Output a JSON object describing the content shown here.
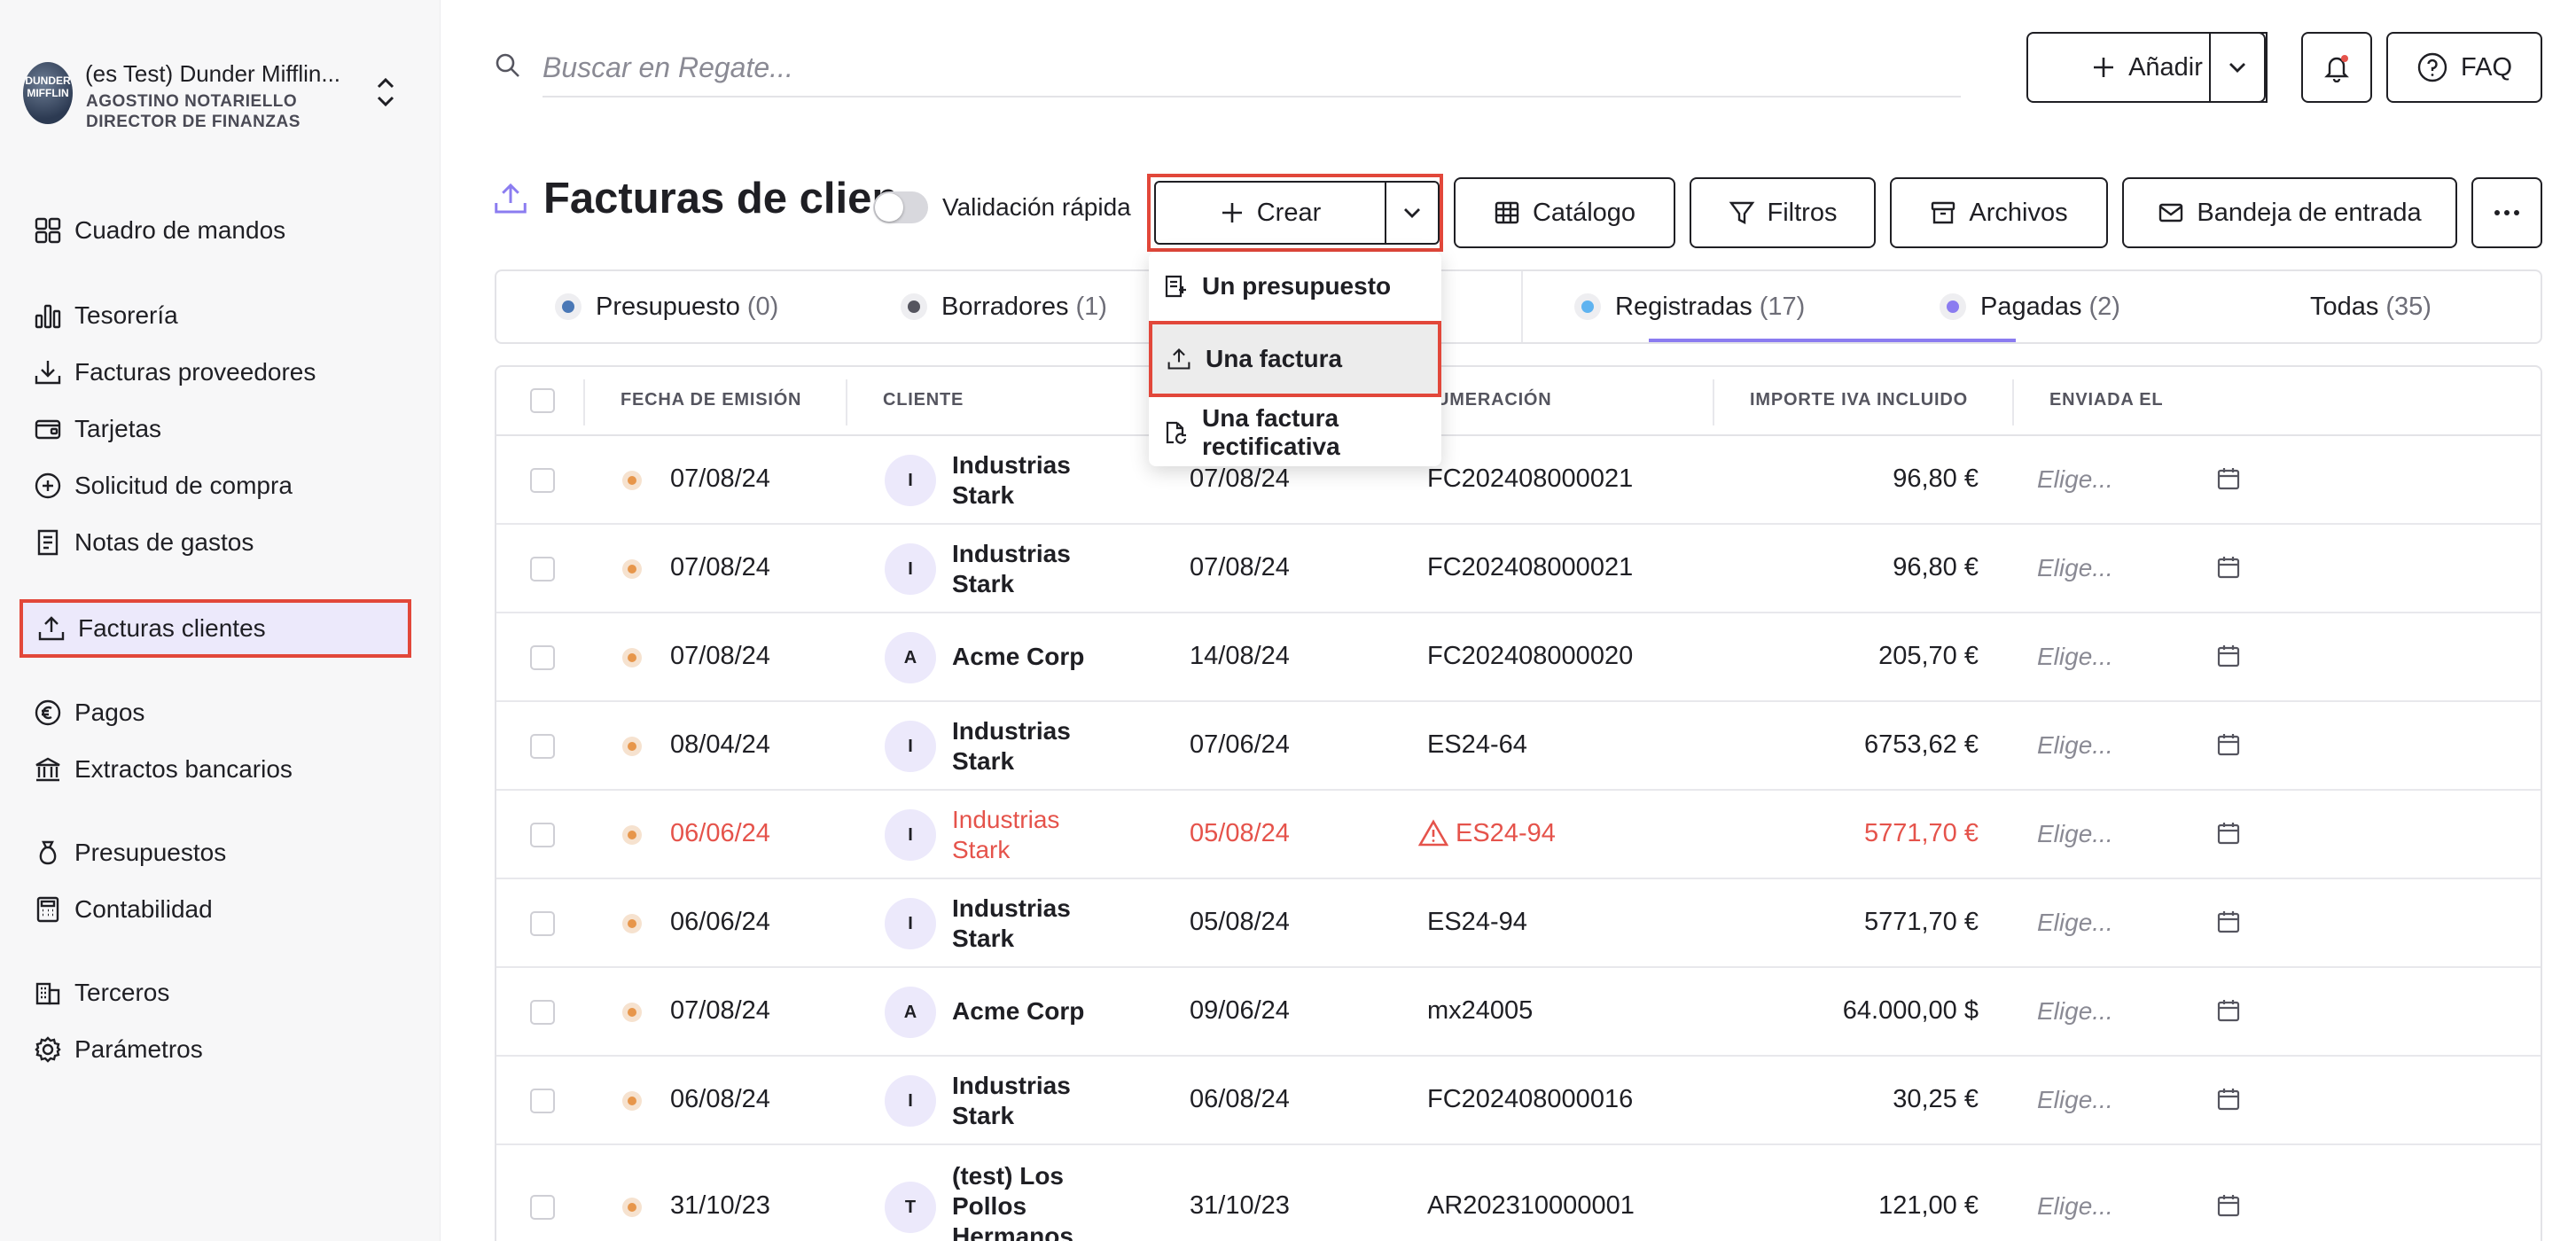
{
  "company": {
    "name": "(es Test) Dunder Mifflin...",
    "logo_text": "DUNDER MIFFLIN",
    "user": "AGOSTINO NOTARIELLO",
    "role": "DIRECTOR DE FINANZAS"
  },
  "sidebar": {
    "items": [
      {
        "label": "Cuadro de mandos",
        "icon": "dashboard-icon"
      },
      {
        "label": "Tesorería",
        "icon": "bar-chart-icon"
      },
      {
        "label": "Facturas proveedores",
        "icon": "download-tray-icon"
      },
      {
        "label": "Tarjetas",
        "icon": "wallet-icon"
      },
      {
        "label": "Solicitud de compra",
        "icon": "plus-circle-icon"
      },
      {
        "label": "Notas de gastos",
        "icon": "receipt-icon"
      },
      {
        "label": "Facturas clientes",
        "icon": "upload-tray-icon",
        "active": true
      },
      {
        "label": "Pagos",
        "icon": "euro-icon"
      },
      {
        "label": "Extractos bancarios",
        "icon": "bank-icon"
      },
      {
        "label": "Presupuestos",
        "icon": "money-bag-icon"
      },
      {
        "label": "Contabilidad",
        "icon": "calculator-icon"
      },
      {
        "label": "Terceros",
        "icon": "building-icon"
      },
      {
        "label": "Parámetros",
        "icon": "gear-icon"
      }
    ]
  },
  "search": {
    "placeholder": "Buscar en Regate..."
  },
  "toolbar": {
    "add_label": "Añadir",
    "faq_label": "FAQ"
  },
  "page": {
    "title": "Facturas de clientes",
    "quick_validation": "Validación rápida",
    "create_label": "Crear",
    "catalog_label": "Catálogo",
    "filters_label": "Filtros",
    "files_label": "Archivos",
    "inbox_label": "Bandeja de entrada"
  },
  "dropdown": {
    "items": [
      {
        "label": "Un presupuesto"
      },
      {
        "label": "Una factura"
      },
      {
        "label": "Una factura rectificativa"
      }
    ]
  },
  "tabs": [
    {
      "label": "Presupuesto",
      "count": "(0)",
      "color": "#4a78b6"
    },
    {
      "label": "Borradores",
      "count": "(1)",
      "color": "#55555f"
    },
    {
      "label": "Registradas",
      "count": "(17)",
      "color": "#5fb3f0"
    },
    {
      "label": "Pagadas",
      "count": "(2)",
      "color": "#8b7cf0"
    },
    {
      "label": "Todas",
      "count": "(35)"
    }
  ],
  "table": {
    "headers": {
      "issue_date": "FECHA DE EMISIÓN",
      "client": "CLIENTE",
      "numbering": "UMERACIÓN",
      "amount": "IMPORTE IVA INCLUIDO",
      "sent": "ENVIADA EL"
    },
    "pick_placeholder": "Elige...",
    "rows": [
      {
        "issue": "07/08/24",
        "initial": "I",
        "client": "Industrias Stark",
        "due": "07/08/24",
        "number": "FC202408000021",
        "amount": "96,80 €"
      },
      {
        "issue": "07/08/24",
        "initial": "I",
        "client": "Industrias Stark",
        "due": "07/08/24",
        "number": "FC202408000021",
        "amount": "96,80 €"
      },
      {
        "issue": "07/08/24",
        "initial": "A",
        "client": "Acme Corp",
        "due": "14/08/24",
        "number": "FC202408000020",
        "amount": "205,70 €"
      },
      {
        "issue": "08/04/24",
        "initial": "I",
        "client": "Industrias Stark",
        "due": "07/06/24",
        "number": "ES24-64",
        "amount": "6753,62 €"
      },
      {
        "issue": "06/06/24",
        "initial": "I",
        "client": "Industrias Stark",
        "due": "05/08/24",
        "number": "ES24-94",
        "amount": "5771,70 €",
        "error": true
      },
      {
        "issue": "06/06/24",
        "initial": "I",
        "client": "Industrias Stark",
        "due": "05/08/24",
        "number": "ES24-94",
        "amount": "5771,70 €"
      },
      {
        "issue": "07/08/24",
        "initial": "A",
        "client": "Acme Corp",
        "due": "09/06/24",
        "number": "mx24005",
        "amount": "64.000,00 $"
      },
      {
        "issue": "06/08/24",
        "initial": "I",
        "client": "Industrias Stark",
        "due": "06/08/24",
        "number": "FC202408000016",
        "amount": "30,25 €"
      },
      {
        "issue": "31/10/23",
        "initial": "T",
        "client": "(test) Los Pollos Hermanos",
        "due": "31/10/23",
        "number": "AR202310000001",
        "amount": "121,00 €"
      }
    ]
  }
}
